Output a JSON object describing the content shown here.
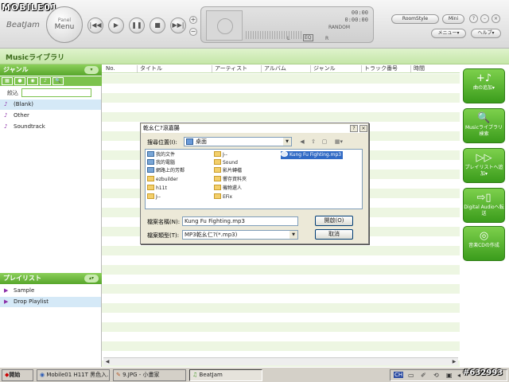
{
  "watermark_top": "MOBILE01",
  "app": {
    "logo": "BeatJam"
  },
  "panel_menu": {
    "small": "Panel",
    "large": "Menu"
  },
  "transport": [
    {
      "name": "prev-button",
      "icon": "|◀◀"
    },
    {
      "name": "play-button",
      "icon": "▶"
    },
    {
      "name": "pause-button",
      "icon": "❚❚"
    },
    {
      "name": "stop-button",
      "icon": "■"
    },
    {
      "name": "next-button",
      "icon": "▶▶|"
    }
  ],
  "volume": {
    "up": "+",
    "down": "−"
  },
  "lcd": {
    "time1": "00:00",
    "time2": "0:00:00",
    "random": "RANDOM",
    "l": "L",
    "r": "R",
    "eq": "EQ"
  },
  "top_right": {
    "roomstyle": "RoomStyle",
    "mini": "Mini",
    "menu": "メニュー▾",
    "help": "ヘルプ▾"
  },
  "library_title": "Musicライブラリ",
  "genre_panel": {
    "title": "ジャンル",
    "filter_label": "絞込"
  },
  "genres": [
    "(Blank)",
    "Other",
    "Soundtrack"
  ],
  "playlist_panel": {
    "title": "プレイリスト"
  },
  "playlists": [
    "Sample",
    "Drop Playlist"
  ],
  "columns": [
    "No.",
    "タイトル",
    "アーティスト",
    "アルバム",
    "ジャンル",
    "トラック番号",
    "時間"
  ],
  "actions": [
    {
      "icon": "+♪",
      "label": "曲の追加▾"
    },
    {
      "icon": "🔍",
      "label": "Musicライブラリ検索"
    },
    {
      "icon": "▷▷",
      "label": "プレイリストへ追加▾"
    },
    {
      "icon": "⇨▯",
      "label": "Digital Audioへ転送"
    },
    {
      "icon": "◎",
      "label": "音楽CDの作成"
    }
  ],
  "dialog": {
    "title": "乾幺仁?滾嘉腸",
    "look_in_label": "搜尋位置(I):",
    "look_in_value": "桌面",
    "files_col1": [
      "我的文件",
      "我的電腦",
      "網路上的芳鄰",
      "ezbuilder",
      "h11t",
      "J--"
    ],
    "files_col2": [
      "J--",
      "Sound",
      "影片轉檔",
      "響存資料夾",
      "機物還人",
      "EFix"
    ],
    "selected_file": "Kung Fu Fighting.mp3",
    "filename_label": "檔案名稱(N):",
    "filename_value": "Kung Fu Fighting.mp3",
    "filetype_label": "檔案類型(T):",
    "filetype_value": "MP3乾幺仁?(*.mp3)",
    "open_button": "開啟(O)",
    "cancel_button": "取消"
  },
  "taskbar": {
    "start": "開始",
    "tasks": [
      "Mobile01 H11T 黑色入...",
      "9.JPG - 小畫家",
      "BeatJam"
    ],
    "lang": "CH"
  },
  "watermark_bottom": "#632993"
}
